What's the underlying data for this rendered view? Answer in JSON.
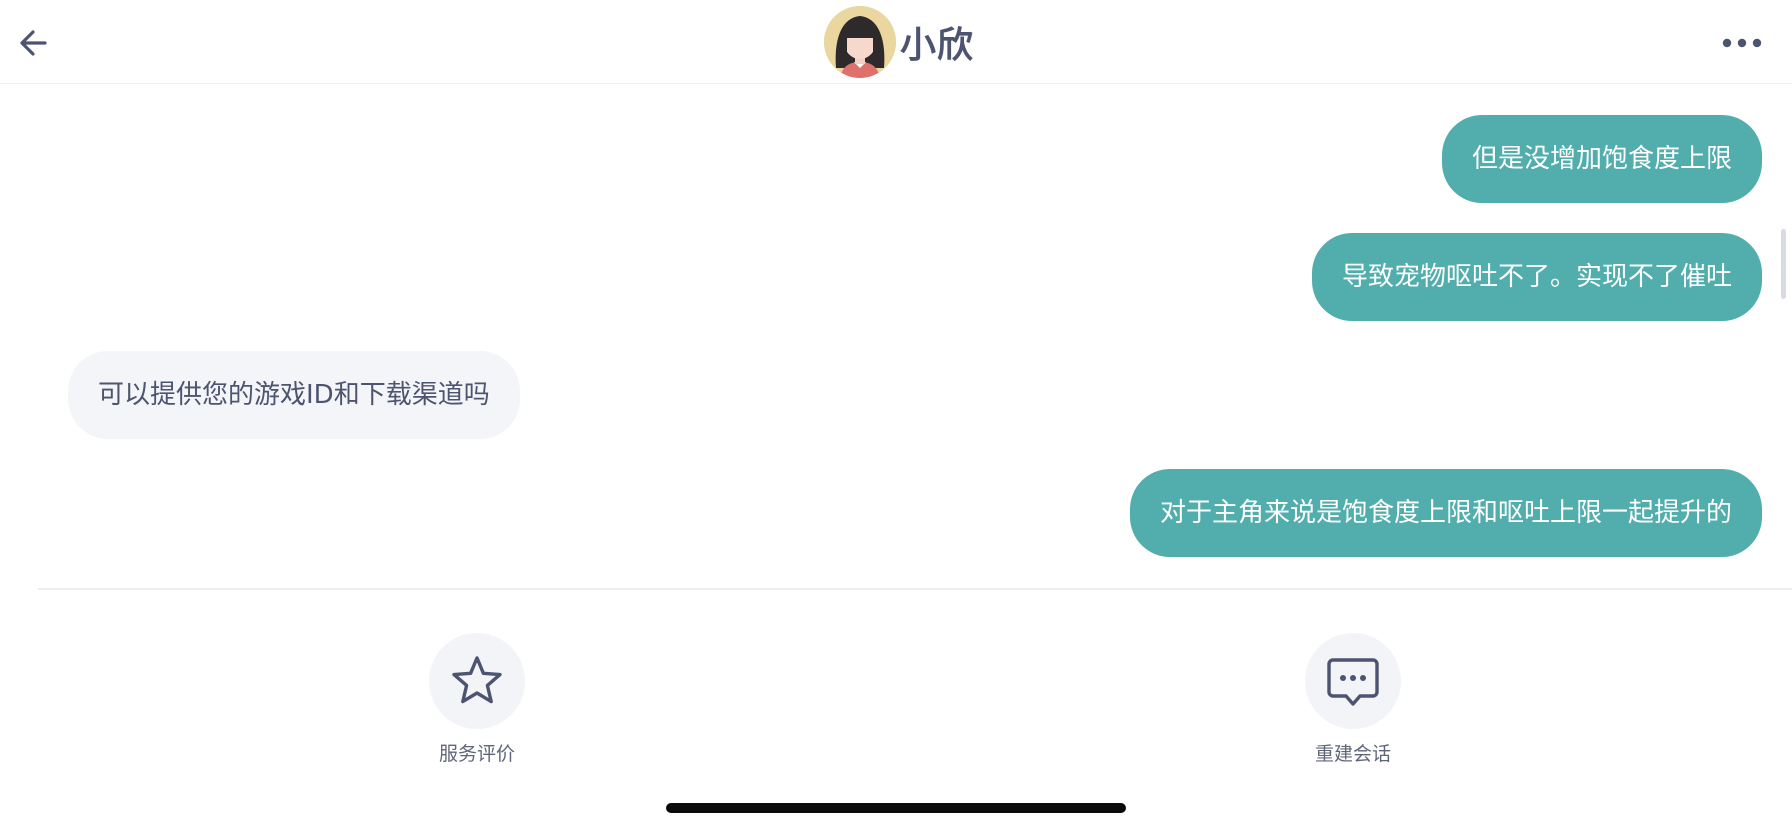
{
  "header": {
    "title": "小欣",
    "back_icon": "arrow-left-icon",
    "more_icon": "more-horizontal-icon"
  },
  "messages": [
    {
      "side": "out",
      "text": "但是没增加饱食度上限"
    },
    {
      "side": "out",
      "text": "导致宠物呕吐不了。实现不了催吐"
    },
    {
      "side": "in",
      "text": "可以提供您的游戏ID和下载渠道吗"
    },
    {
      "side": "out",
      "text": "对于主角来说是饱食度上限和呕吐上限一起提升的"
    }
  ],
  "actions": {
    "rate": {
      "label": "服务评价",
      "icon": "star-icon"
    },
    "restart": {
      "label": "重建会话",
      "icon": "chat-bubble-dots-icon"
    }
  },
  "colors": {
    "outgoing_bubble": "#52adad",
    "incoming_bubble": "#f4f5f8",
    "text_primary": "#4d5470"
  }
}
